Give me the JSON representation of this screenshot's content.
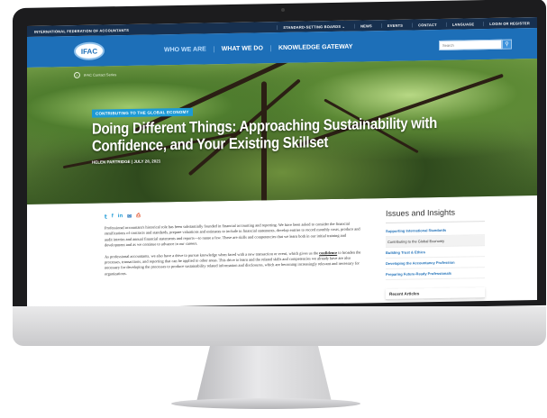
{
  "topbar": {
    "org": "INTERNATIONAL FEDERATION OF ACCOUNTANTS",
    "links": [
      "STANDARD-SETTING BOARDS ⌄",
      "NEWS",
      "EVENTS",
      "CONTACT",
      "LANGUAGE",
      "LOGIN OR REGISTER"
    ]
  },
  "nav": {
    "logo": "IFAC",
    "items": [
      "WHO WE ARE",
      "WHAT WE DO",
      "KNOWLEDGE GATEWAY"
    ],
    "search_placeholder": "Search"
  },
  "hero": {
    "breadcrumb": "IFAC Contact Series",
    "tag": "CONTRIBUTING TO THE GLOBAL ECONOMY",
    "title": "Doing Different Things: Approaching Sustainability with Confidence, and Your Existing Skillset",
    "byline": "HELEN PARTRIDGE | JULY 28, 2021"
  },
  "article": {
    "share_icons": [
      "twitter-icon",
      "facebook-icon",
      "linkedin-icon",
      "email-icon",
      "print-icon"
    ],
    "p1": "Professional accountant's historical role has been substantially founded in financial accounting and reporting. We have been asked to consider the financial ramifications of contracts and standards, prepare valuations and estimates to include in financial statements, develop entries to record monthly costs, produce and audit interim and annual financial statements and reports—to name a few. These are skills and competencies that we learn both in our initial training and development and as we continue to advance in our careers.",
    "p2_before": "As professional accountants, we also have a drive to pursue knowledge when faced with a new transaction or event, which gives us the ",
    "p2_link": "confidence",
    "p2_after": " to broaden the processes, transactions, and reporting that can be applied to other areas. This drive to learn and the related skills and competencies we already have are also necessary for developing the processes to produce sustainability related information and disclosures, which are becoming increasingly relevant and necessary for organizations."
  },
  "sidebar": {
    "heading": "Issues and Insights",
    "items": [
      "Supporting International Standards",
      "Contributing to the Global Economy",
      "Building Trust & Ethics",
      "Developing the Accountancy Profession",
      "Preparing Future-Ready Professionals"
    ],
    "recent": "Recent Articles"
  }
}
